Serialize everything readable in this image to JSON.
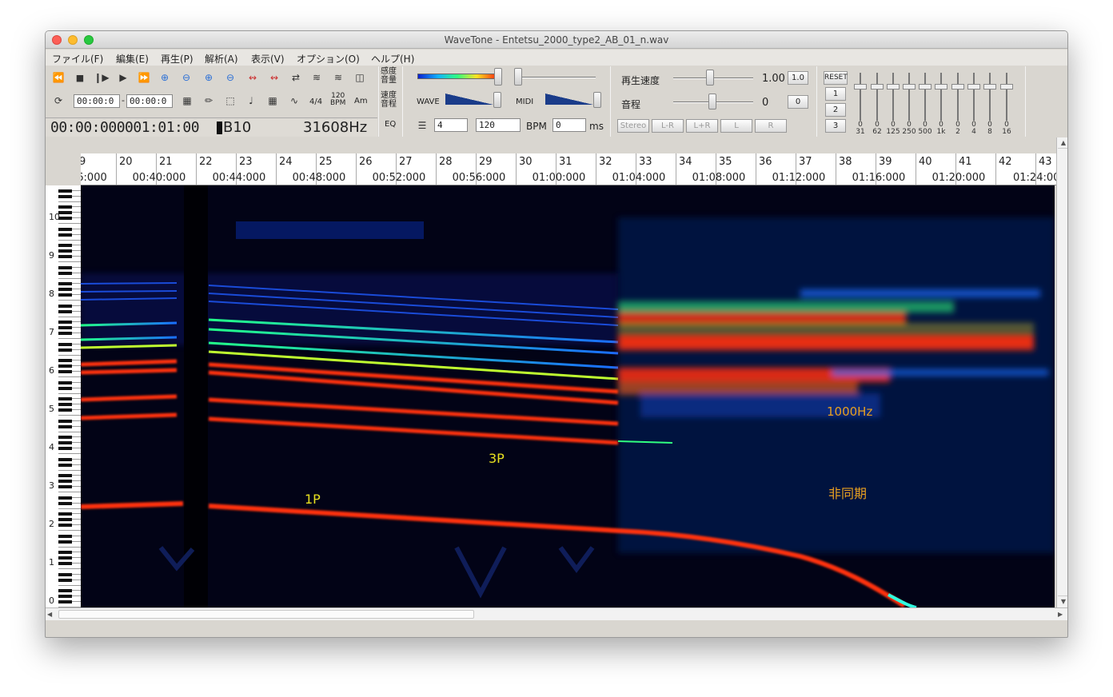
{
  "window": {
    "title": "WaveTone - Entetsu_2000_type2_AB_01_n.wav"
  },
  "menu": [
    "ファイル(F)",
    "編集(E)",
    "再生(P)",
    "解析(A)",
    "表示(V)",
    "オプション(O)",
    "ヘルプ(H)"
  ],
  "toolbar": {
    "loop_start": "00:00:0",
    "loop_end": "00:00:0",
    "time_sig": "4/4",
    "bpm_icon_top": "120",
    "bpm_icon_bottom": "BPM",
    "chord_icon": "Am",
    "position": "00:00:000001:01:00",
    "note": "B10",
    "frequency": "31608Hz",
    "eq_label": "EQ",
    "beats": "4",
    "bpm": "120",
    "bpm_label": "BPM",
    "offset": "0",
    "ms_label": "ms"
  },
  "sensitivity": {
    "label_top": "感度",
    "label_bottom": "音量",
    "speed_label_top": "速度",
    "speed_label_bottom": "音程",
    "wave_label": "WAVE",
    "midi_label": "MIDI"
  },
  "playback": {
    "speed_label": "再生速度",
    "speed_value": "1.00",
    "speed_reset": "1.0",
    "pitch_label": "音程",
    "pitch_value": "0",
    "pitch_reset": "0",
    "channels": [
      "Stereo",
      "L-R",
      "L+R",
      "L",
      "R"
    ]
  },
  "eq": {
    "reset_label": "RESET",
    "presets": [
      "1",
      "2",
      "3"
    ],
    "bands": [
      "31",
      "62",
      "125",
      "250",
      "500",
      "1k",
      "2",
      "4",
      "8",
      "16"
    ]
  },
  "ruler": {
    "measures": [
      "9",
      "20",
      "21",
      "22",
      "23",
      "24",
      "25",
      "26",
      "27",
      "28",
      "29",
      "30",
      "31",
      "32",
      "33",
      "34",
      "35",
      "36",
      "37",
      "38",
      "39",
      "40",
      "41",
      "42",
      "43"
    ],
    "times": [
      "6:000",
      "00:40:000",
      "00:44:000",
      "00:48:000",
      "00:52:000",
      "00:56:000",
      "01:00:000",
      "01:04:000",
      "01:08:000",
      "01:12:000",
      "01:16:000",
      "01:20:000",
      "01:24:00"
    ]
  },
  "octaves": [
    "10",
    "9",
    "8",
    "7",
    "6",
    "5",
    "4",
    "3",
    "2",
    "1",
    "0"
  ],
  "annotations": {
    "p1": "1P",
    "p3": "3P",
    "hz1000": "1000Hz",
    "async": "非同期"
  },
  "colors": {
    "annotation_yellow": "#e8e020",
    "annotation_orange": "#e8a020",
    "spectrum_red": "#ff3010",
    "spectrum_background": "#020316"
  }
}
